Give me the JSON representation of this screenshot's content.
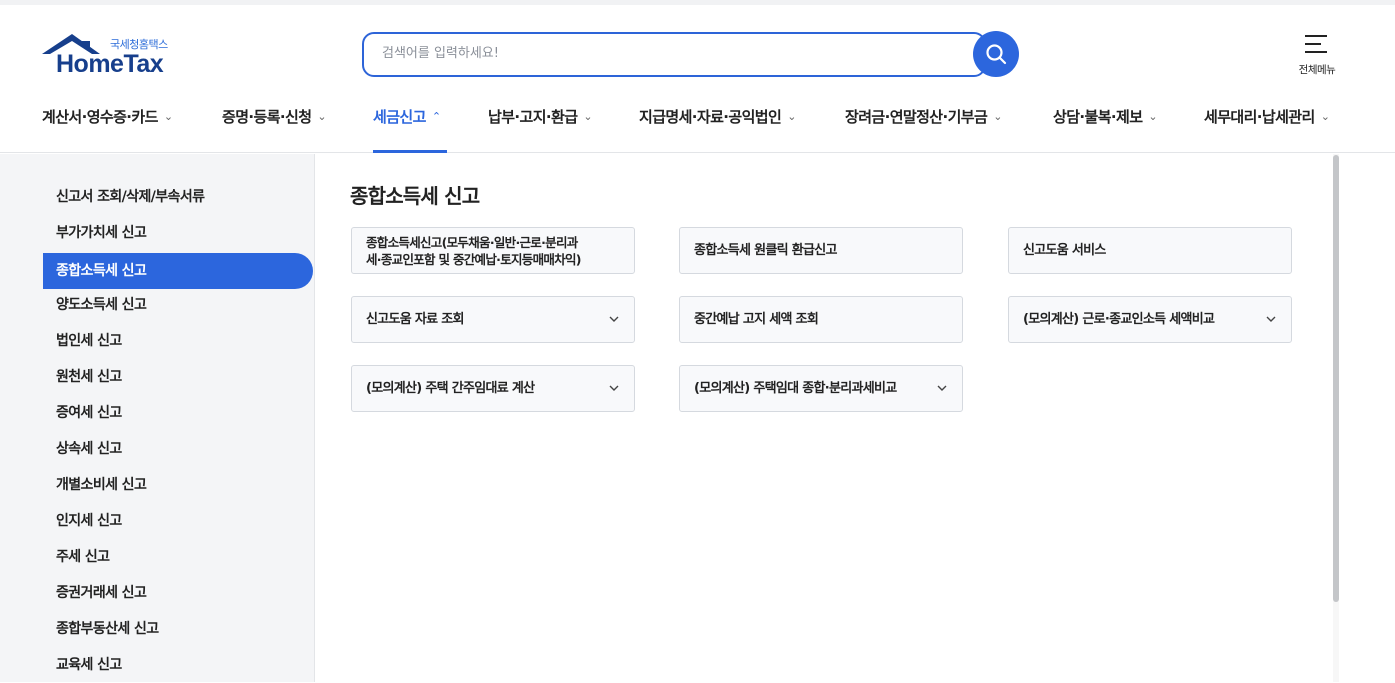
{
  "header": {
    "logo_sub": "국세청홈택스",
    "logo_main": "HomeTax",
    "search_placeholder": "검색어를 입력하세요!",
    "all_menu_label": "전체메뉴"
  },
  "nav": {
    "items": [
      {
        "label": "계산서·영수증·카드",
        "chevron": "⌄"
      },
      {
        "label": "증명·등록·신청",
        "chevron": "⌄"
      },
      {
        "label": "세금신고",
        "chevron": "⌃"
      },
      {
        "label": "납부·고지·환급",
        "chevron": "⌄"
      },
      {
        "label": "지급명세·자료·공익법인",
        "chevron": "⌄"
      },
      {
        "label": "장려금·연말정산·기부금",
        "chevron": "⌄"
      },
      {
        "label": "상담·불복·제보",
        "chevron": "⌄"
      },
      {
        "label": "세무대리·납세관리",
        "chevron": "⌄"
      }
    ],
    "active_index": 2
  },
  "sidebar": {
    "items": [
      {
        "label": "신고서 조회/삭제/부속서류"
      },
      {
        "label": "부가가치세 신고"
      },
      {
        "label": "종합소득세 신고"
      },
      {
        "label": "양도소득세 신고"
      },
      {
        "label": "법인세 신고"
      },
      {
        "label": "원천세 신고"
      },
      {
        "label": "증여세 신고"
      },
      {
        "label": "상속세 신고"
      },
      {
        "label": "개별소비세 신고"
      },
      {
        "label": "인지세 신고"
      },
      {
        "label": "주세 신고"
      },
      {
        "label": "증권거래세 신고"
      },
      {
        "label": "종합부동산세 신고"
      },
      {
        "label": "교육세 신고"
      }
    ],
    "active_index": 2
  },
  "main": {
    "title": "종합소득세 신고",
    "cards": [
      {
        "line1": "종합소득세신고(모두채움·일반·근로·분리과",
        "line2": "세·종교인포함 및 중간예납·토지등매매차익)",
        "has_dropdown": false
      },
      {
        "line1": "종합소득세 원클릭 환급신고",
        "line2": "",
        "has_dropdown": false
      },
      {
        "line1": "신고도움 서비스",
        "line2": "",
        "has_dropdown": false
      },
      {
        "line1": "신고도움 자료 조회",
        "line2": "",
        "has_dropdown": true
      },
      {
        "line1": "중간예납 고지 세액 조회",
        "line2": "",
        "has_dropdown": false
      },
      {
        "line1": "(모의계산) 근로·종교인소득 세액비교",
        "line2": "",
        "has_dropdown": true
      },
      {
        "line1": "(모의계산) 주택 간주임대료 계산",
        "line2": "",
        "has_dropdown": true
      },
      {
        "line1": "(모의계산) 주택임대 종합·분리과세비교",
        "line2": "",
        "has_dropdown": true
      }
    ]
  },
  "icons": {
    "logo": "house-roof-icon",
    "search": "search-icon",
    "all_menu": "hamburger-icon",
    "card_dropdown": "chevron-down-icon"
  },
  "colors": {
    "accent": "#2c66dd",
    "logo_navy": "#173f8c",
    "sidebar_bg": "#f4f5f7",
    "card_bg": "#f8f9fb"
  }
}
